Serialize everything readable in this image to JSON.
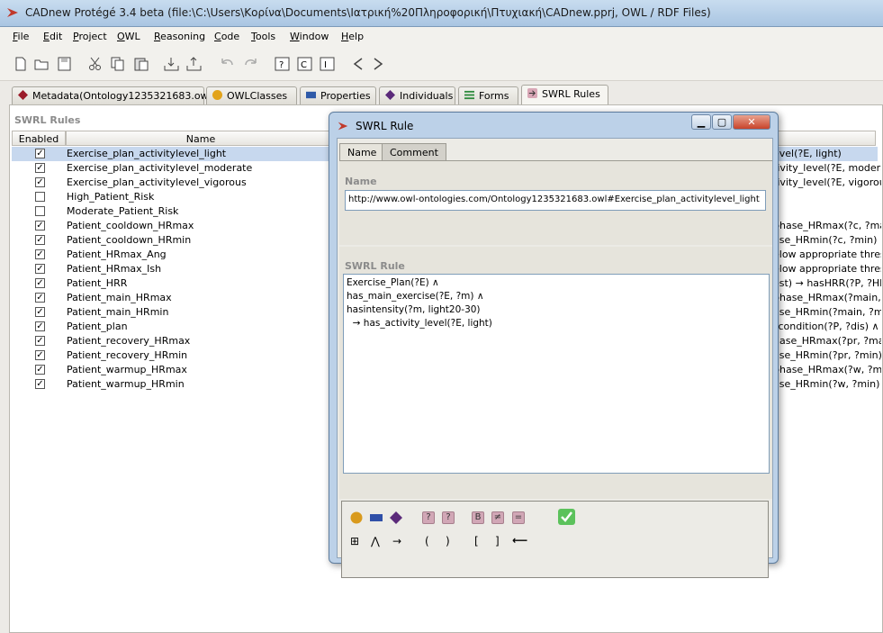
{
  "window": {
    "title": "CADnew  Protégé 3.4 beta    (file:\\C:\\Users\\Κορίνα\\Documents\\Ιατρική%20Πληροφορική\\Πτυχιακή\\CADnew.pprj, OWL / RDF Files)"
  },
  "menu": [
    "File",
    "Edit",
    "Project",
    "OWL",
    "Reasoning",
    "Code",
    "Tools",
    "Window",
    "Help"
  ],
  "menu_mnemonic": [
    "F",
    "E",
    "P",
    "O",
    "R",
    "C",
    "T",
    "W",
    "H"
  ],
  "tabs": [
    {
      "label": "Metadata(Ontology1235321683.owl)",
      "icon": "diamond-icon",
      "color": "#9b1c2a"
    },
    {
      "label": "OWLClasses",
      "icon": "circle-icon",
      "color": "#e2a31b"
    },
    {
      "label": "Properties",
      "icon": "rectangle-icon",
      "color": "#2f5aa8"
    },
    {
      "label": "Individuals",
      "icon": "diamond-icon",
      "color": "#5b2a7a"
    },
    {
      "label": "Forms",
      "icon": "form-icon",
      "color": "#2e8b3d"
    },
    {
      "label": "SWRL Rules",
      "icon": "arrow-icon",
      "color": "#c0446a"
    }
  ],
  "panel": {
    "title": "SWRL Rules"
  },
  "table": {
    "headers": [
      "Enabled",
      "Name"
    ],
    "rows": [
      {
        "enabled": true,
        "name": "Exercise_plan_activitylevel_light",
        "expr": "evel(?E, light)"
      },
      {
        "enabled": true,
        "name": "Exercise_plan_activitylevel_moderate",
        "expr": "tivity_level(?E, moderate"
      },
      {
        "enabled": true,
        "name": "Exercise_plan_activitylevel_vigorous",
        "expr": "tivity_level(?E, vigorous)"
      },
      {
        "enabled": false,
        "name": "High_Patient_Risk",
        "expr": ""
      },
      {
        "enabled": false,
        "name": "Moderate_Patient_Risk",
        "expr": ""
      },
      {
        "enabled": true,
        "name": "Patient_cooldown_HRmax",
        "expr": "phase_HRmax(?c, ?max"
      },
      {
        "enabled": true,
        "name": "Patient_cooldown_HRmin",
        "expr": "ase_HRmin(?c, ?min)"
      },
      {
        "enabled": true,
        "name": "Patient_HRmax_Ang",
        "expr": "elow appropriate thresol"
      },
      {
        "enabled": true,
        "name": "Patient_HRmax_Ish",
        "expr": "elow appropriate thresol"
      },
      {
        "enabled": true,
        "name": "Patient_HRR",
        "expr": "est) → hasHRR(?P, ?HRI"
      },
      {
        "enabled": true,
        "name": "Patient_main_HRmax",
        "expr": "phase_HRmax(?main, ?n"
      },
      {
        "enabled": true,
        "name": "Patient_main_HRmin",
        "expr": "ase_HRmin(?main, ?min"
      },
      {
        "enabled": true,
        "name": "Patient_plan",
        "expr": "_condition(?P, ?dis)  ∧"
      },
      {
        "enabled": true,
        "name": "Patient_recovery_HRmax",
        "expr": "hase_HRmax(?pr, ?max)"
      },
      {
        "enabled": true,
        "name": "Patient_recovery_HRmin",
        "expr": "ase_HRmin(?pr, ?min)"
      },
      {
        "enabled": true,
        "name": "Patient_warmup_HRmax",
        "expr": "phase_HRmax(?w, ?max"
      },
      {
        "enabled": true,
        "name": "Patient_warmup_HRmin",
        "expr": "ase_HRmin(?w, ?min)"
      }
    ]
  },
  "dialog": {
    "title": "SWRL Rule",
    "tabs": [
      "Name",
      "Comment"
    ],
    "name_label": "Name",
    "name_value": "http://www.owl-ontologies.com/Ontology1235321683.owl#Exercise_plan_activitylevel_light",
    "rule_label": "SWRL Rule",
    "rule_lines": [
      "Exercise_Plan(?E)  ∧",
      "has_main_exercise(?E, ?m)  ∧",
      "hasintensity(?m, light20-30)",
      "  → has_activity_level(?E, light)"
    ]
  },
  "palette": {
    "row2": [
      "⊞",
      "⋀",
      "→",
      "(",
      ")",
      "[",
      "]",
      "⟵"
    ],
    "letters": [
      "?",
      "?",
      "B",
      "≠",
      "="
    ]
  }
}
